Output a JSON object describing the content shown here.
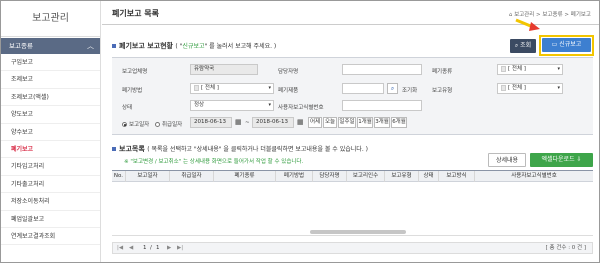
{
  "sidebar": {
    "title": "보고관리",
    "section": "보고종류",
    "items": [
      "구입보고",
      "조제보고",
      "조제보고(액셀)",
      "양도보고",
      "양수보고",
      "폐기보고",
      "기타입고처리",
      "기타출고처리",
      "저장소이동처리",
      "폐업일괄보고",
      "연계보고결과조회"
    ],
    "active_index": 5
  },
  "header": {
    "title": "폐기보고 목록",
    "breadcrumb": "보고관리 > 보고종류 > 폐기보고"
  },
  "status_section": {
    "title": "폐기보고 보고현황",
    "note_prefix": "( \"",
    "note_green": "신규보고",
    "note_suffix": "\" 를 눌러서 보고해 주세요. )",
    "search_btn": "조회",
    "new_report_btn": "신규보고"
  },
  "form": {
    "org_type_label": "보고업체명",
    "org_type_value": "유람약국",
    "manager_label": "담당자명",
    "manager_value": "",
    "disposal_type_label": "폐기종류",
    "disposal_type_value": "[ 전체 ]",
    "method_label": "폐기방법",
    "method_value": "[ 전체 ]",
    "product_label": "폐기제품",
    "product_value": "",
    "lookup_label": "조기화",
    "report_type_label": "보고유형",
    "report_type_value": "[ 전체 ]",
    "status_label": "상태",
    "status_value": "정상",
    "user_id_label": "사용자보고식별번호",
    "user_id_value": "",
    "date_radio_1": "보고일자",
    "date_radio_2": "취급일자",
    "date_from": "2018-06-13",
    "date_sep": "~",
    "date_to": "2018-06-13",
    "period_buttons": [
      "어제",
      "오늘",
      "일주일",
      "1개월",
      "3개월",
      "6개월"
    ]
  },
  "list_section": {
    "title": "보고목록",
    "note": "( 목록을 선택하고 \"상세내용\" 을 클릭하거나 더블클릭하면 보고내용을 볼 수 있습니다. )",
    "note2": "※ \"보고변경 / 보고취소\" 는 상세내용 화면으로 들어가서 작업 할 수 있습니다.",
    "detail_btn": "상세내용",
    "excel_btn": "엑셀다운로드",
    "columns": [
      "No.",
      "보고일자",
      "취급일자",
      "폐기종류",
      "폐기방법",
      "담당자명",
      "보고리인수",
      "보고유형",
      "상태",
      "보고방식",
      "사용자보고식별번호"
    ]
  },
  "pager": {
    "page_current": "1",
    "page_sep": "/",
    "page_total": "1",
    "total_text": "[ 총 건수 : 0 건 ]"
  },
  "colors": {
    "sidebar_section": "#5a6a85",
    "highlight": "#f2c500",
    "new_report": "#3d7fd0",
    "excel": "#3ea54a",
    "active_menu": "#d9304a"
  }
}
